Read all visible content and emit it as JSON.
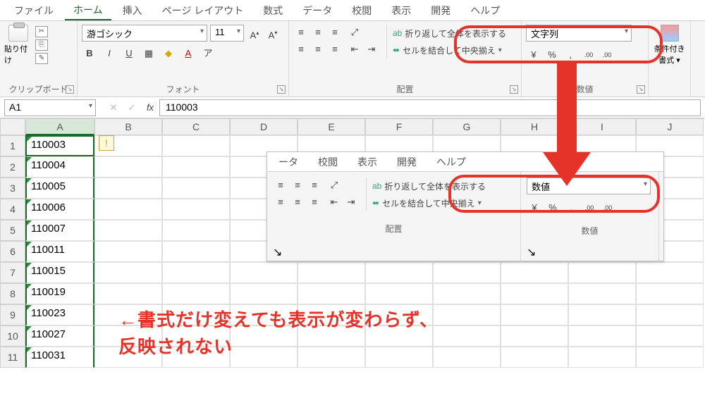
{
  "menu": {
    "file": "ファイル",
    "home": "ホーム",
    "insert": "挿入",
    "pagelayout": "ページ レイアウト",
    "formulas": "数式",
    "data": "データ",
    "review": "校閲",
    "view": "表示",
    "developer": "開発",
    "help": "ヘルプ"
  },
  "ribbon": {
    "clipboard": {
      "paste": "貼り付け",
      "label": "クリップボード"
    },
    "font": {
      "name": "游ゴシック",
      "size": "11",
      "bold": "B",
      "italic": "I",
      "underline": "U",
      "label": "フォント",
      "grow": "A",
      "shrink": "A"
    },
    "align": {
      "wrap": "折り返して全体を表示する",
      "merge": "セルを結合して中央揃え",
      "label": "配置"
    },
    "number": {
      "format": "文字列",
      "label": "数値"
    },
    "cond": {
      "label": "条件付き\n書式 ▾"
    }
  },
  "namebox": "A1",
  "formula": "110003",
  "columns": [
    "A",
    "B",
    "C",
    "D",
    "E",
    "F",
    "G",
    "H",
    "I",
    "J"
  ],
  "rownums": [
    "1",
    "2",
    "3",
    "4",
    "5",
    "6",
    "7",
    "8",
    "9",
    "10",
    "11"
  ],
  "cellsA": [
    "110003",
    "110004",
    "110005",
    "110006",
    "110007",
    "110011",
    "110015",
    "110019",
    "110023",
    "110027",
    "110031"
  ],
  "overlay": {
    "tabs": {
      "data_partial": "ータ",
      "review": "校閲",
      "view": "表示",
      "developer": "開発",
      "help": "ヘルプ"
    },
    "align": {
      "wrap": "折り返して全体を表示する",
      "merge": "セルを結合して中央揃え",
      "label": "配置"
    },
    "number": {
      "format": "数値",
      "label": "数値"
    }
  },
  "annotation": {
    "line1": "←書式だけ変えても表示が変わらず、",
    "line2": "反映されない"
  },
  "icons": {
    "wrap": "ab",
    "merge": "⬌",
    "currency": "¥",
    "percent": "%",
    "comma": ",",
    "dec_inc": ".00",
    "dec_dec": ".00",
    "fx": "fx",
    "check": "✓",
    "x": "✕",
    "border": "▦",
    "fill": "◆",
    "fontcolor": "A"
  }
}
